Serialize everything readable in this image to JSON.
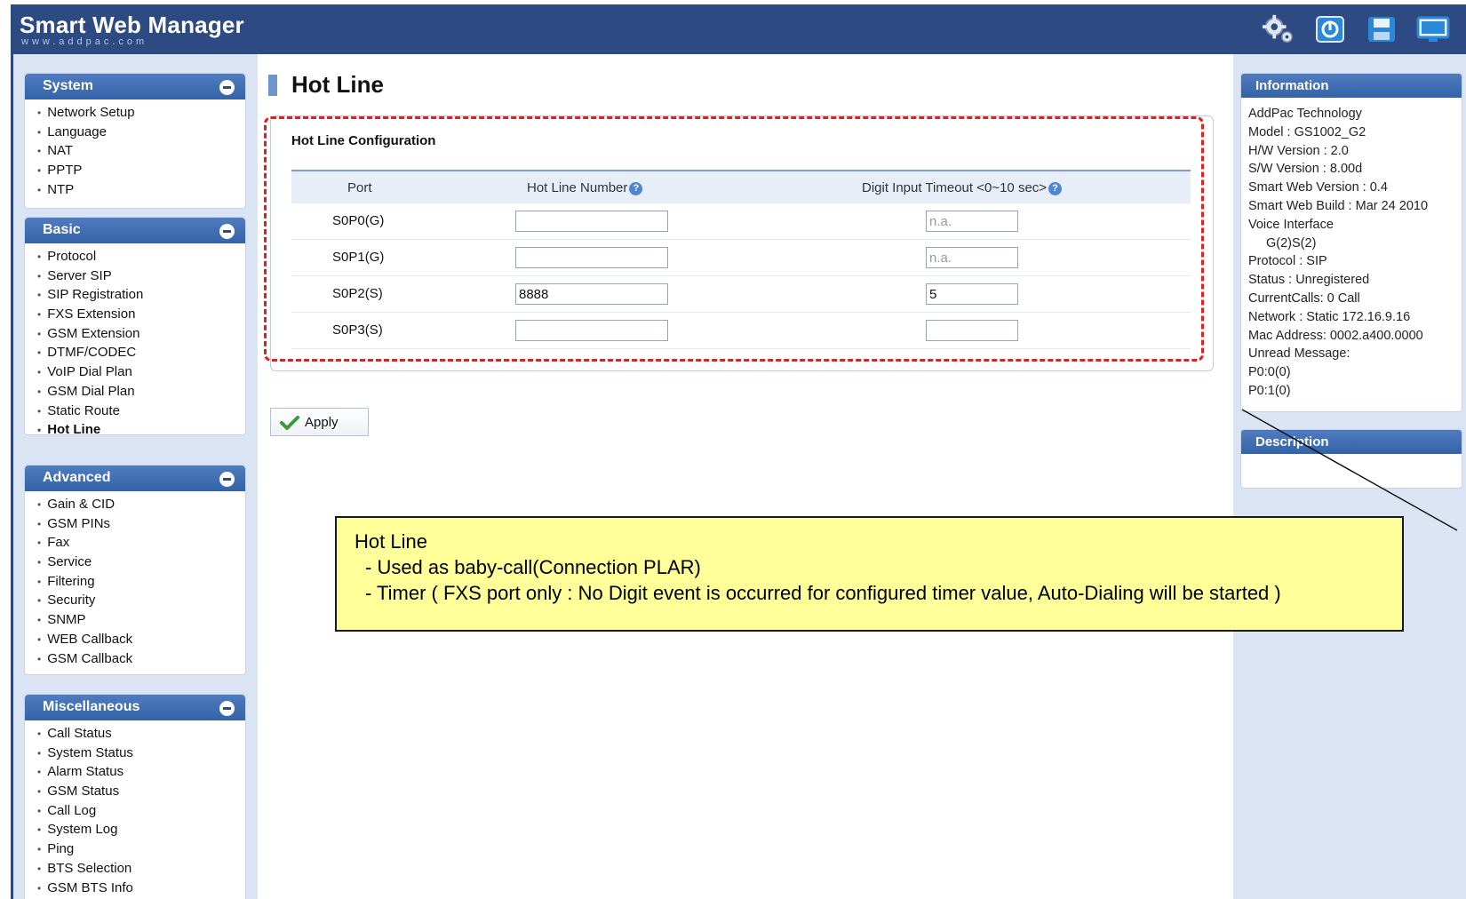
{
  "header": {
    "title": "Smart Web Manager",
    "subtitle": "www.addpac.com",
    "icons": [
      "settings-gear-icon",
      "power-icon",
      "save-disk-icon",
      "monitor-icon"
    ]
  },
  "sidebar": {
    "system": {
      "title": "System",
      "items": [
        "Network Setup",
        "Language",
        "NAT",
        "PPTP",
        "NTP"
      ]
    },
    "basic": {
      "title": "Basic",
      "items": [
        "Protocol",
        "Server SIP",
        "SIP Registration",
        "FXS Extension",
        "GSM Extension",
        "DTMF/CODEC",
        "VoIP Dial Plan",
        "GSM Dial Plan",
        "Static Route",
        "Hot Line"
      ]
    },
    "advanced": {
      "title": "Advanced",
      "items": [
        "Gain & CID",
        "GSM PINs",
        "Fax",
        "Service",
        "Filtering",
        "Security",
        "SNMP",
        "WEB Callback",
        "GSM Callback"
      ]
    },
    "misc": {
      "title": "Miscellaneous",
      "items": [
        "Call Status",
        "System Status",
        "Alarm Status",
        "GSM Status",
        "Call Log",
        "System Log",
        "Ping",
        "BTS Selection",
        "GSM BTS Info"
      ]
    }
  },
  "main": {
    "title": "Hot Line",
    "config_title": "Hot Line Configuration",
    "columns": [
      "Port",
      "Hot Line Number",
      "Digit Input Timeout <0~10 sec>"
    ],
    "rows": [
      {
        "port": "S0P0(G)",
        "number": "",
        "timeout": "",
        "timeout_placeholder": "n.a."
      },
      {
        "port": "S0P1(G)",
        "number": "",
        "timeout": "",
        "timeout_placeholder": "n.a."
      },
      {
        "port": "S0P2(S)",
        "number": "8888",
        "timeout": "5",
        "timeout_placeholder": ""
      },
      {
        "port": "S0P3(S)",
        "number": "",
        "timeout": "",
        "timeout_placeholder": ""
      }
    ],
    "apply_label": "Apply"
  },
  "info": {
    "title": "Information",
    "lines": [
      "AddPac Technology",
      "Model : GS1002_G2",
      "H/W Version : 2.0",
      "S/W Version : 8.00d",
      "Smart Web Version : 0.4",
      "Smart Web Build : Mar 24 2010",
      "Voice Interface",
      "G(2)S(2)",
      "Protocol : SIP",
      "Status : Unregistered",
      "CurrentCalls: 0 Call",
      "Network : Static 172.16.9.16",
      "Mac Address: 0002.a400.0000",
      "Unread Message:",
      "P0:0(0)",
      "P0:1(0)"
    ]
  },
  "description": {
    "title": "Description"
  },
  "annotation": {
    "title": "Hot Line",
    "lines": [
      "- Used as baby-call(Connection PLAR)",
      "- Timer ( FXS port only : No Digit event is occurred for  configured timer value, Auto-Dialing will be started )"
    ]
  }
}
